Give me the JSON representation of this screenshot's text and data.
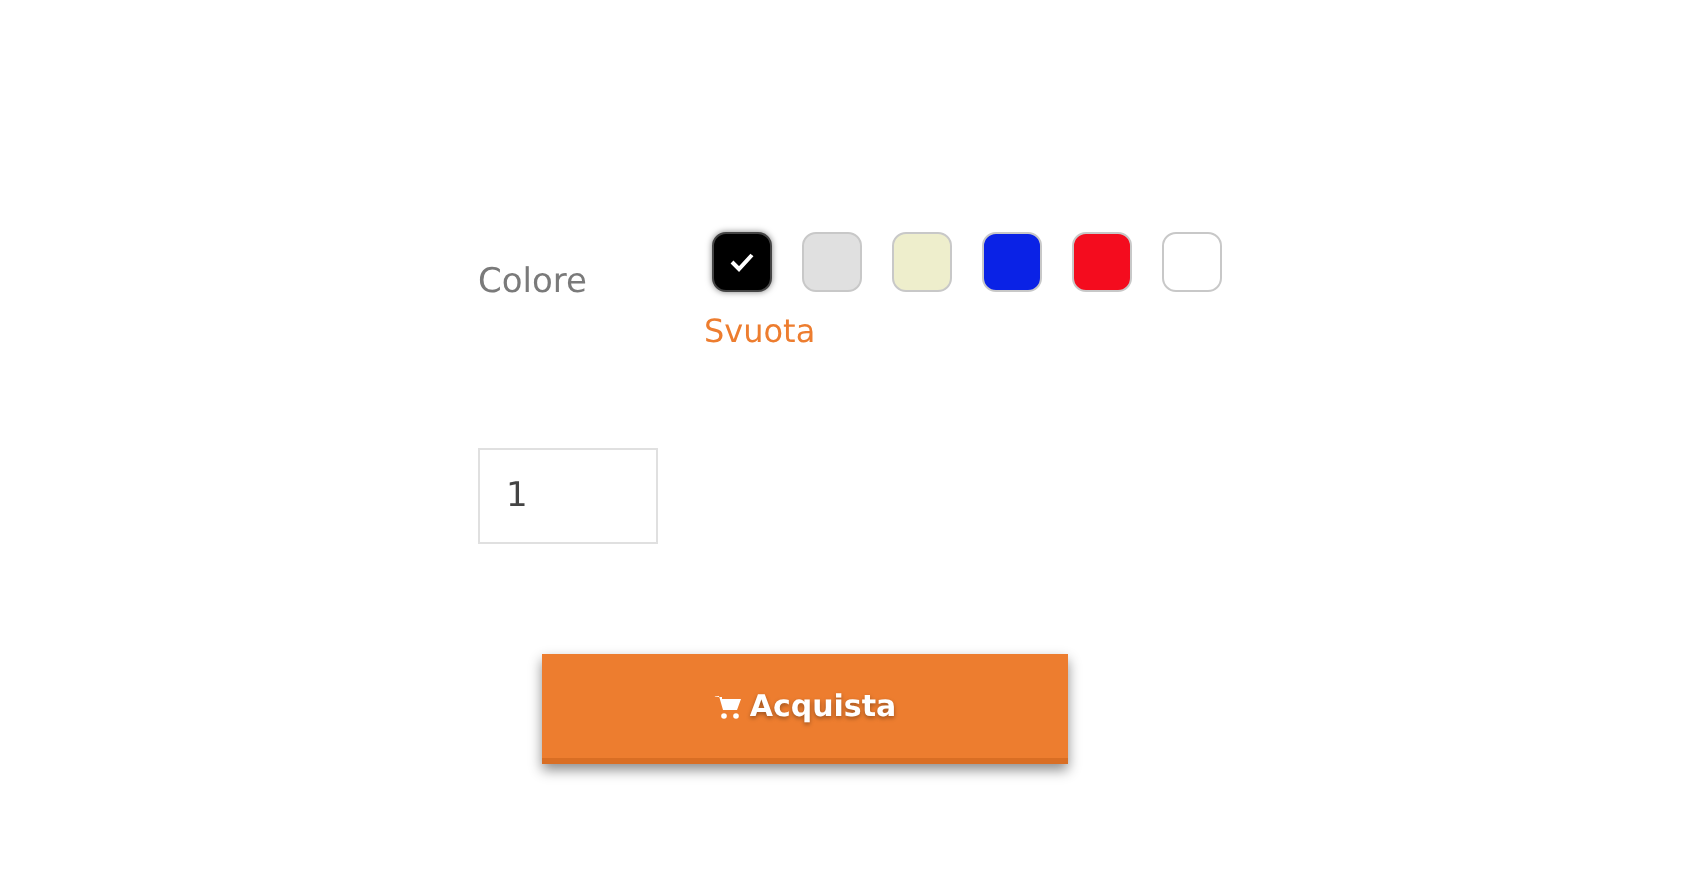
{
  "color_option": {
    "label": "Colore",
    "swatches": [
      {
        "color": "#000000",
        "selected": true
      },
      {
        "color": "#e0e0e0",
        "selected": false
      },
      {
        "color": "#eeeecc",
        "selected": false
      },
      {
        "color": "#0a22e6",
        "selected": false
      },
      {
        "color": "#f40c1e",
        "selected": false
      },
      {
        "color": "#ffffff",
        "selected": false
      }
    ],
    "clear_link": "Svuota"
  },
  "quantity": {
    "value": "1"
  },
  "buy_button": {
    "label": "Acquista"
  }
}
